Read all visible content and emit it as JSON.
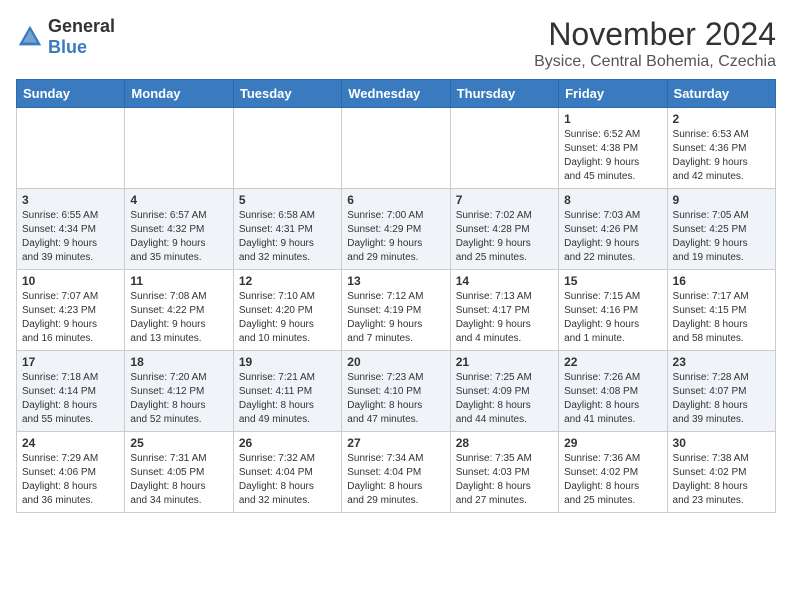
{
  "header": {
    "logo_general": "General",
    "logo_blue": "Blue",
    "month": "November 2024",
    "location": "Bysice, Central Bohemia, Czechia"
  },
  "weekdays": [
    "Sunday",
    "Monday",
    "Tuesday",
    "Wednesday",
    "Thursday",
    "Friday",
    "Saturday"
  ],
  "weeks": [
    [
      {
        "day": "",
        "info": ""
      },
      {
        "day": "",
        "info": ""
      },
      {
        "day": "",
        "info": ""
      },
      {
        "day": "",
        "info": ""
      },
      {
        "day": "",
        "info": ""
      },
      {
        "day": "1",
        "info": "Sunrise: 6:52 AM\nSunset: 4:38 PM\nDaylight: 9 hours\nand 45 minutes."
      },
      {
        "day": "2",
        "info": "Sunrise: 6:53 AM\nSunset: 4:36 PM\nDaylight: 9 hours\nand 42 minutes."
      }
    ],
    [
      {
        "day": "3",
        "info": "Sunrise: 6:55 AM\nSunset: 4:34 PM\nDaylight: 9 hours\nand 39 minutes."
      },
      {
        "day": "4",
        "info": "Sunrise: 6:57 AM\nSunset: 4:32 PM\nDaylight: 9 hours\nand 35 minutes."
      },
      {
        "day": "5",
        "info": "Sunrise: 6:58 AM\nSunset: 4:31 PM\nDaylight: 9 hours\nand 32 minutes."
      },
      {
        "day": "6",
        "info": "Sunrise: 7:00 AM\nSunset: 4:29 PM\nDaylight: 9 hours\nand 29 minutes."
      },
      {
        "day": "7",
        "info": "Sunrise: 7:02 AM\nSunset: 4:28 PM\nDaylight: 9 hours\nand 25 minutes."
      },
      {
        "day": "8",
        "info": "Sunrise: 7:03 AM\nSunset: 4:26 PM\nDaylight: 9 hours\nand 22 minutes."
      },
      {
        "day": "9",
        "info": "Sunrise: 7:05 AM\nSunset: 4:25 PM\nDaylight: 9 hours\nand 19 minutes."
      }
    ],
    [
      {
        "day": "10",
        "info": "Sunrise: 7:07 AM\nSunset: 4:23 PM\nDaylight: 9 hours\nand 16 minutes."
      },
      {
        "day": "11",
        "info": "Sunrise: 7:08 AM\nSunset: 4:22 PM\nDaylight: 9 hours\nand 13 minutes."
      },
      {
        "day": "12",
        "info": "Sunrise: 7:10 AM\nSunset: 4:20 PM\nDaylight: 9 hours\nand 10 minutes."
      },
      {
        "day": "13",
        "info": "Sunrise: 7:12 AM\nSunset: 4:19 PM\nDaylight: 9 hours\nand 7 minutes."
      },
      {
        "day": "14",
        "info": "Sunrise: 7:13 AM\nSunset: 4:17 PM\nDaylight: 9 hours\nand 4 minutes."
      },
      {
        "day": "15",
        "info": "Sunrise: 7:15 AM\nSunset: 4:16 PM\nDaylight: 9 hours\nand 1 minute."
      },
      {
        "day": "16",
        "info": "Sunrise: 7:17 AM\nSunset: 4:15 PM\nDaylight: 8 hours\nand 58 minutes."
      }
    ],
    [
      {
        "day": "17",
        "info": "Sunrise: 7:18 AM\nSunset: 4:14 PM\nDaylight: 8 hours\nand 55 minutes."
      },
      {
        "day": "18",
        "info": "Sunrise: 7:20 AM\nSunset: 4:12 PM\nDaylight: 8 hours\nand 52 minutes."
      },
      {
        "day": "19",
        "info": "Sunrise: 7:21 AM\nSunset: 4:11 PM\nDaylight: 8 hours\nand 49 minutes."
      },
      {
        "day": "20",
        "info": "Sunrise: 7:23 AM\nSunset: 4:10 PM\nDaylight: 8 hours\nand 47 minutes."
      },
      {
        "day": "21",
        "info": "Sunrise: 7:25 AM\nSunset: 4:09 PM\nDaylight: 8 hours\nand 44 minutes."
      },
      {
        "day": "22",
        "info": "Sunrise: 7:26 AM\nSunset: 4:08 PM\nDaylight: 8 hours\nand 41 minutes."
      },
      {
        "day": "23",
        "info": "Sunrise: 7:28 AM\nSunset: 4:07 PM\nDaylight: 8 hours\nand 39 minutes."
      }
    ],
    [
      {
        "day": "24",
        "info": "Sunrise: 7:29 AM\nSunset: 4:06 PM\nDaylight: 8 hours\nand 36 minutes."
      },
      {
        "day": "25",
        "info": "Sunrise: 7:31 AM\nSunset: 4:05 PM\nDaylight: 8 hours\nand 34 minutes."
      },
      {
        "day": "26",
        "info": "Sunrise: 7:32 AM\nSunset: 4:04 PM\nDaylight: 8 hours\nand 32 minutes."
      },
      {
        "day": "27",
        "info": "Sunrise: 7:34 AM\nSunset: 4:04 PM\nDaylight: 8 hours\nand 29 minutes."
      },
      {
        "day": "28",
        "info": "Sunrise: 7:35 AM\nSunset: 4:03 PM\nDaylight: 8 hours\nand 27 minutes."
      },
      {
        "day": "29",
        "info": "Sunrise: 7:36 AM\nSunset: 4:02 PM\nDaylight: 8 hours\nand 25 minutes."
      },
      {
        "day": "30",
        "info": "Sunrise: 7:38 AM\nSunset: 4:02 PM\nDaylight: 8 hours\nand 23 minutes."
      }
    ]
  ]
}
